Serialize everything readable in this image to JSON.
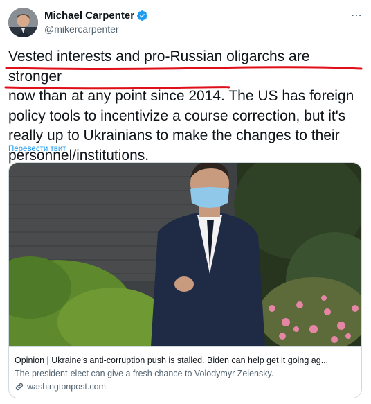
{
  "author": {
    "name": "Michael Carpenter",
    "handle": "@mikercarpenter"
  },
  "tweet": {
    "lines": [
      "Vested interests and pro-Russian oligarchs are stronger",
      "now than at any point since 2014. The US has foreign",
      "policy tools to incentivize a course correction, but it's",
      "really up to Ukrainians to make the changes to their",
      "personnel/institutions."
    ],
    "translate_label": "Перевести твит"
  },
  "card": {
    "title": "Opinion | Ukraine's anti-corruption push is stalled. Biden can help get it going ag...",
    "description": "The president-elect can give a fresh chance to Volodymyr Zelensky.",
    "domain": "washingtonpost.com",
    "link_icon": "link-icon"
  },
  "icons": {
    "verified": "verified-badge-icon",
    "more": "more-options-icon"
  },
  "colors": {
    "link": "#1d9bf0",
    "underline": "#e0101b",
    "secondary": "#536471"
  }
}
